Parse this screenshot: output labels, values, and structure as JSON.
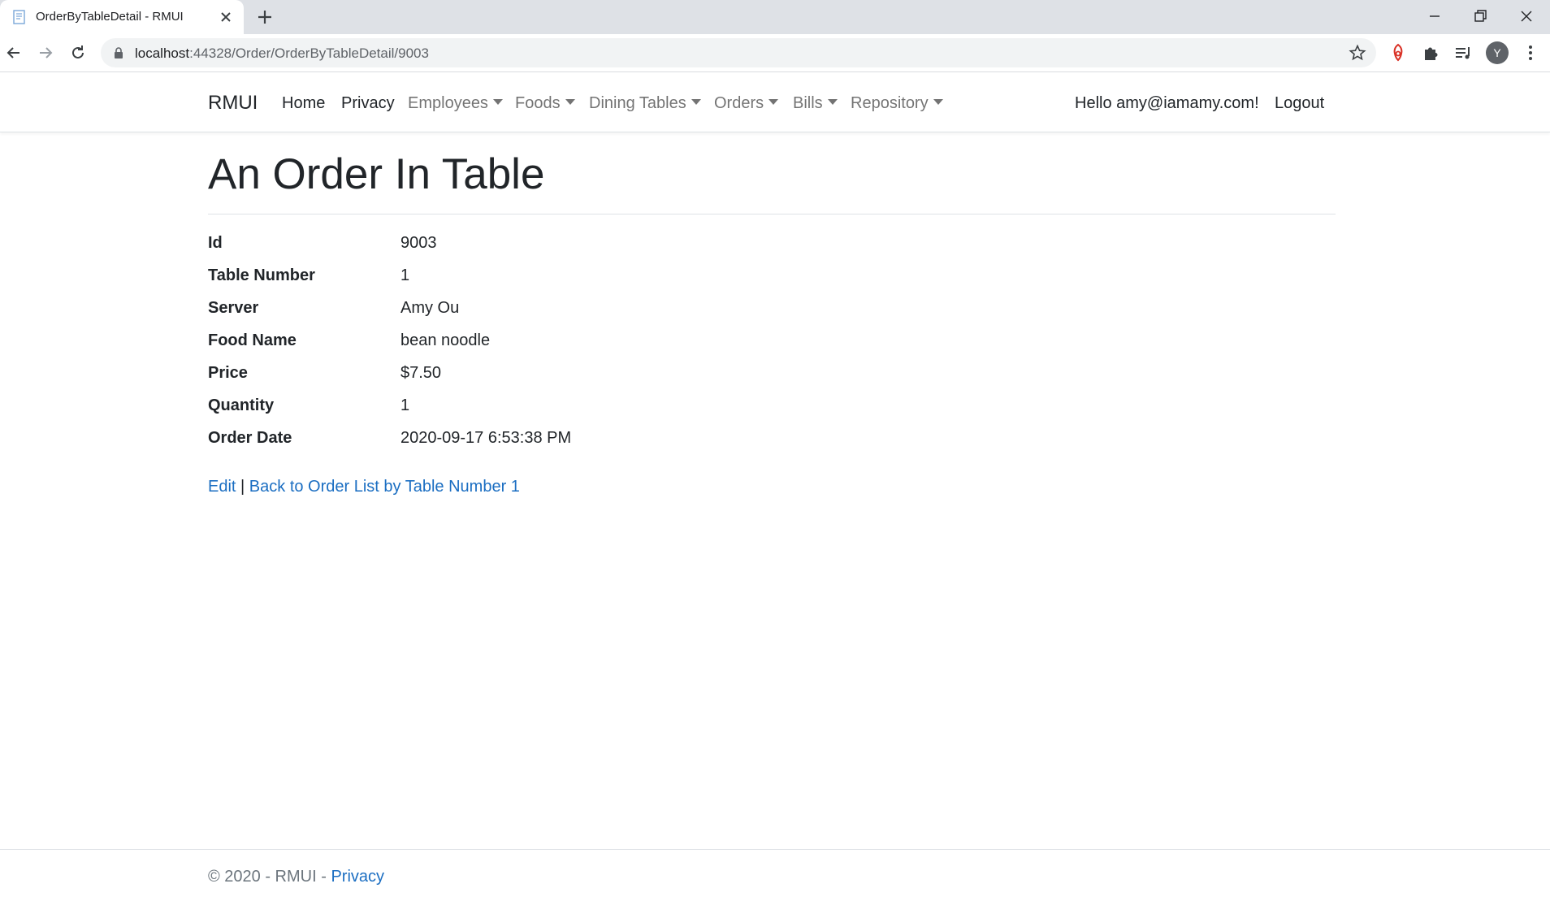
{
  "browser": {
    "tab_title": "OrderByTableDetail - RMUI",
    "url_host": "localhost",
    "url_path": ":44328/Order/OrderByTableDetail/9003",
    "profile_initial": "Y"
  },
  "navbar": {
    "brand": "RMUI",
    "items": [
      {
        "label": "Home"
      },
      {
        "label": "Privacy"
      },
      {
        "label": "Employees"
      },
      {
        "label": "Foods"
      },
      {
        "label": "Dining Tables"
      },
      {
        "label": "Orders"
      },
      {
        "label": "Bills"
      },
      {
        "label": "Repository"
      }
    ],
    "greeting": "Hello amy@iamamy.com!",
    "logout": "Logout"
  },
  "main": {
    "title": "An Order In Table",
    "fields": [
      {
        "label": "Id",
        "value": "9003"
      },
      {
        "label": "Table Number",
        "value": "1"
      },
      {
        "label": "Server",
        "value": "Amy Ou"
      },
      {
        "label": "Food Name",
        "value": "bean noodle"
      },
      {
        "label": "Price",
        "value": "$7.50"
      },
      {
        "label": "Quantity",
        "value": "1"
      },
      {
        "label": "Order Date",
        "value": "2020-09-17 6:53:38 PM"
      }
    ],
    "edit_link": "Edit",
    "separator": "|",
    "back_link": "Back to Order List by Table Number 1"
  },
  "footer": {
    "text": "© 2020 - RMUI - ",
    "privacy_link": "Privacy"
  },
  "colors": {
    "link": "#1b6ec2",
    "chrome_tabstrip": "#dee1e6",
    "omnibox": "#f1f3f4"
  }
}
